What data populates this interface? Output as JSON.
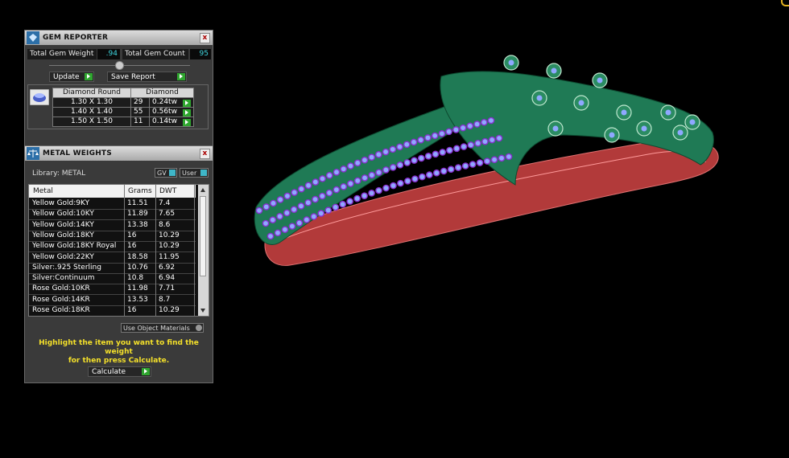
{
  "gem_reporter": {
    "title": "GEM REPORTER",
    "close_label": "x",
    "total_gem_weight_label": "Total Gem Weight",
    "total_gem_weight_value": ".94",
    "total_gem_count_label": "Total Gem Count",
    "total_gem_count_value": "95",
    "update_label": "Update",
    "save_report_label": "Save Report",
    "gem_table": {
      "headers": [
        "Diamond Round",
        "Diamond"
      ],
      "rows": [
        {
          "size": "1.30 X 1.30",
          "count": "29",
          "weight": "0.24tw"
        },
        {
          "size": "1.40 X 1.40",
          "count": "55",
          "weight": "0.56tw"
        },
        {
          "size": "1.50 X 1.50",
          "count": "11",
          "weight": "0.14tw"
        }
      ]
    }
  },
  "metal_weights": {
    "title": "METAL WEIGHTS",
    "close_label": "x",
    "library_label": "Library: METAL",
    "gv_label": "GV",
    "user_label": "User",
    "columns": [
      "Metal",
      "Grams",
      "DWT"
    ],
    "rows": [
      {
        "metal": "Yellow Gold:9KY",
        "grams": "11.51",
        "dwt": "7.4"
      },
      {
        "metal": "Yellow Gold:10KY",
        "grams": "11.89",
        "dwt": "7.65"
      },
      {
        "metal": "Yellow Gold:14KY",
        "grams": "13.38",
        "dwt": "8.6"
      },
      {
        "metal": "Yellow Gold:18KY",
        "grams": "16",
        "dwt": "10.29"
      },
      {
        "metal": "Yellow Gold:18KY Royal",
        "grams": "16",
        "dwt": "10.29"
      },
      {
        "metal": "Yellow Gold:22KY",
        "grams": "18.58",
        "dwt": "11.95"
      },
      {
        "metal": "Silver:.925 Sterling",
        "grams": "10.76",
        "dwt": "6.92"
      },
      {
        "metal": "Silver:Continuum",
        "grams": "10.8",
        "dwt": "6.94"
      },
      {
        "metal": "Rose Gold:10KR",
        "grams": "11.98",
        "dwt": "7.71"
      },
      {
        "metal": "Rose Gold:14KR",
        "grams": "13.53",
        "dwt": "8.7"
      },
      {
        "metal": "Rose Gold:18KR",
        "grams": "16",
        "dwt": "10.29"
      }
    ],
    "use_object_materials_label": "Use Object Materials",
    "hint_line1": "Highlight the item you want to find the weight",
    "hint_line2": "for then press Calculate.",
    "calculate_label": "Calculate"
  },
  "colors": {
    "ring_body": "#1f7a55",
    "ring_shank": "#b23a3a",
    "gem_blue": "#8fa8ff",
    "prong_purple": "#8a2fd0"
  }
}
